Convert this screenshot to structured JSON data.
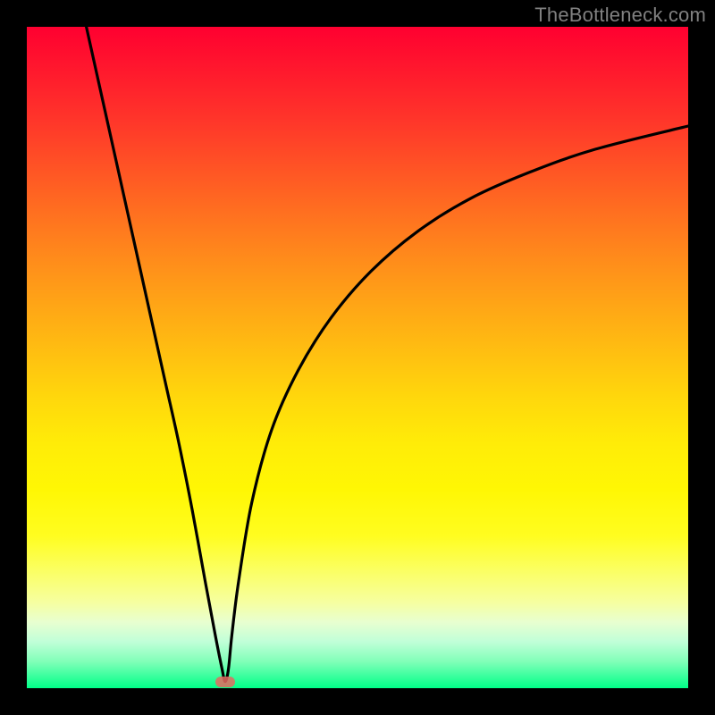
{
  "watermark": "TheBottleneck.com",
  "chart_data": {
    "type": "line",
    "title": "",
    "xlabel": "",
    "ylabel": "",
    "xlim": [
      0,
      100
    ],
    "ylim": [
      0,
      100
    ],
    "series": [
      {
        "name": "curve",
        "x": [
          9,
          11,
          13,
          15,
          17,
          19,
          21,
          23,
          25,
          27,
          28.5,
          29.5,
          30,
          30.5,
          31,
          32,
          34,
          37,
          41,
          46,
          52,
          59,
          67,
          76,
          86,
          100
        ],
        "y": [
          100,
          91,
          82,
          73,
          64,
          55,
          46,
          37,
          27,
          16,
          8,
          3,
          1,
          3,
          8,
          16,
          28,
          39,
          48,
          56,
          63,
          69,
          74,
          78,
          81.5,
          85
        ]
      }
    ],
    "marker": {
      "x": 30,
      "y": 1
    },
    "gradient_stops": [
      {
        "pos": 0,
        "color": "#ff0030"
      },
      {
        "pos": 50,
        "color": "#ffc010"
      },
      {
        "pos": 80,
        "color": "#fcff50"
      },
      {
        "pos": 100,
        "color": "#00ff88"
      }
    ]
  }
}
